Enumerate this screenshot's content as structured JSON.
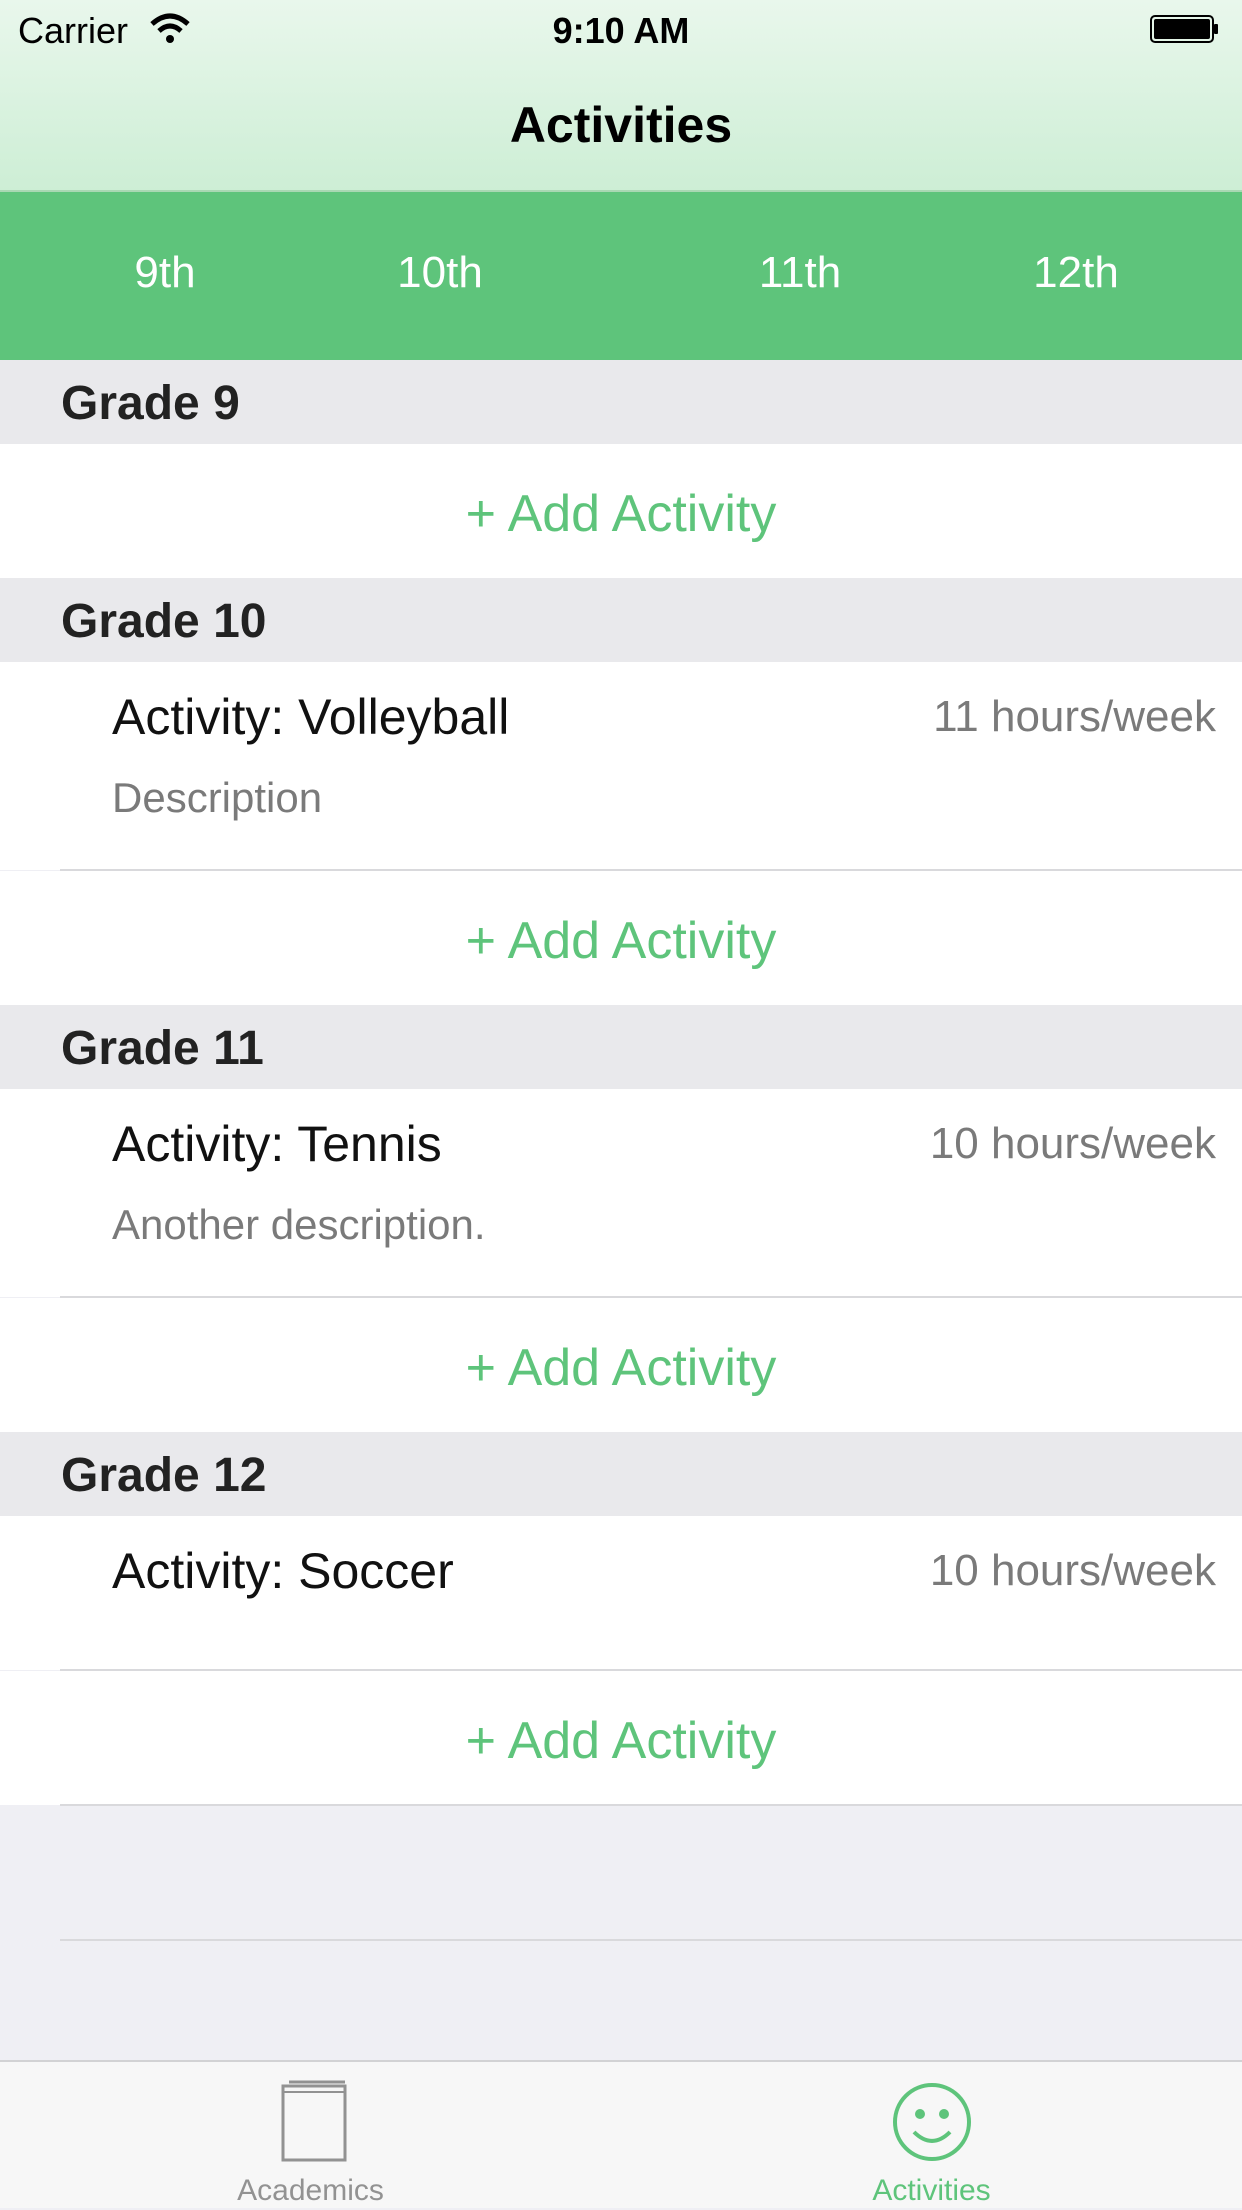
{
  "status": {
    "carrier": "Carrier",
    "time": "9:10 AM"
  },
  "nav": {
    "title": "Activities"
  },
  "grade_tabs": [
    "9th",
    "10th",
    "11th",
    "12th"
  ],
  "sections": [
    {
      "title": "Grade 9",
      "activities": [],
      "add_label": "+ Add Activity"
    },
    {
      "title": "Grade 10",
      "activities": [
        {
          "name": "Activity:  Volleyball",
          "hours": "11 hours/week",
          "description": "Description"
        }
      ],
      "add_label": "+ Add Activity"
    },
    {
      "title": "Grade 11",
      "activities": [
        {
          "name": "Activity:  Tennis",
          "hours": "10 hours/week",
          "description": "Another description."
        }
      ],
      "add_label": "+ Add Activity"
    },
    {
      "title": "Grade 12",
      "activities": [
        {
          "name": "Activity:  Soccer",
          "hours": "10 hours/week",
          "description": ""
        }
      ],
      "add_label": "+ Add Activity"
    }
  ],
  "tabbar": {
    "items": [
      {
        "label": "Academics",
        "icon": "book-icon",
        "selected": false
      },
      {
        "label": "Activities",
        "icon": "smiley-icon",
        "selected": true
      }
    ]
  },
  "colors": {
    "accent": "#5ec47b",
    "inactive": "#929292"
  }
}
